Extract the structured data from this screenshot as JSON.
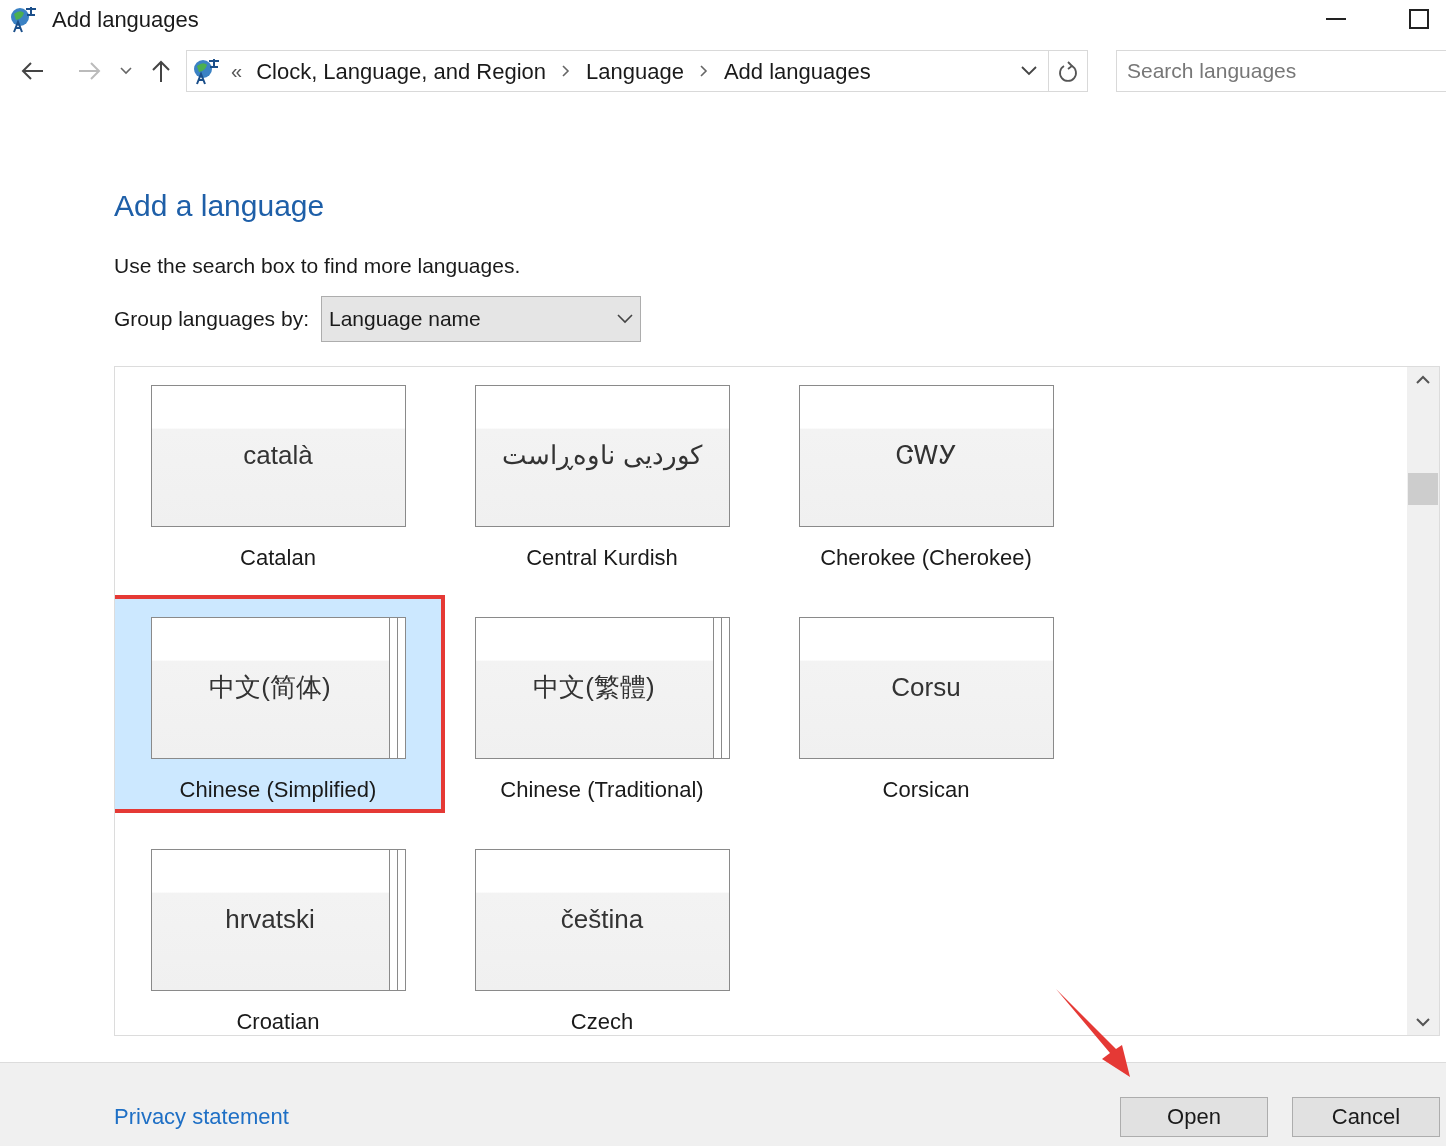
{
  "window": {
    "title": "Add languages"
  },
  "breadcrumb": {
    "overflow": "«",
    "items": [
      "Clock, Language, and Region",
      "Language",
      "Add languages"
    ]
  },
  "search": {
    "placeholder": "Search languages"
  },
  "heading": "Add a language",
  "hint": "Use the search box to find more languages.",
  "group_by": {
    "label": "Group languages by:",
    "value": "Language name"
  },
  "languages": [
    {
      "native": "català",
      "name": "Catalan",
      "selected": false,
      "stacked": false,
      "annotated": false
    },
    {
      "native": "کوردیی ناوەڕاست",
      "name": "Central Kurdish",
      "selected": false,
      "stacked": false,
      "annotated": false
    },
    {
      "native": "ᏣᎳᎩ",
      "name": "Cherokee (Cherokee)",
      "selected": false,
      "stacked": false,
      "annotated": false
    },
    {
      "native": "中文(简体)",
      "name": "Chinese (Simplified)",
      "selected": true,
      "stacked": true,
      "annotated": true
    },
    {
      "native": "中文(繁體)",
      "name": "Chinese (Traditional)",
      "selected": false,
      "stacked": true,
      "annotated": false
    },
    {
      "native": "Corsu",
      "name": "Corsican",
      "selected": false,
      "stacked": false,
      "annotated": false
    },
    {
      "native": "hrvatski",
      "name": "Croatian",
      "selected": false,
      "stacked": true,
      "annotated": false
    },
    {
      "native": "čeština",
      "name": "Czech",
      "selected": false,
      "stacked": false,
      "annotated": false
    }
  ],
  "privacy_link": "Privacy statement",
  "buttons": [
    {
      "label": "Open",
      "annotated": true
    },
    {
      "label": "Cancel",
      "annotated": false
    }
  ]
}
